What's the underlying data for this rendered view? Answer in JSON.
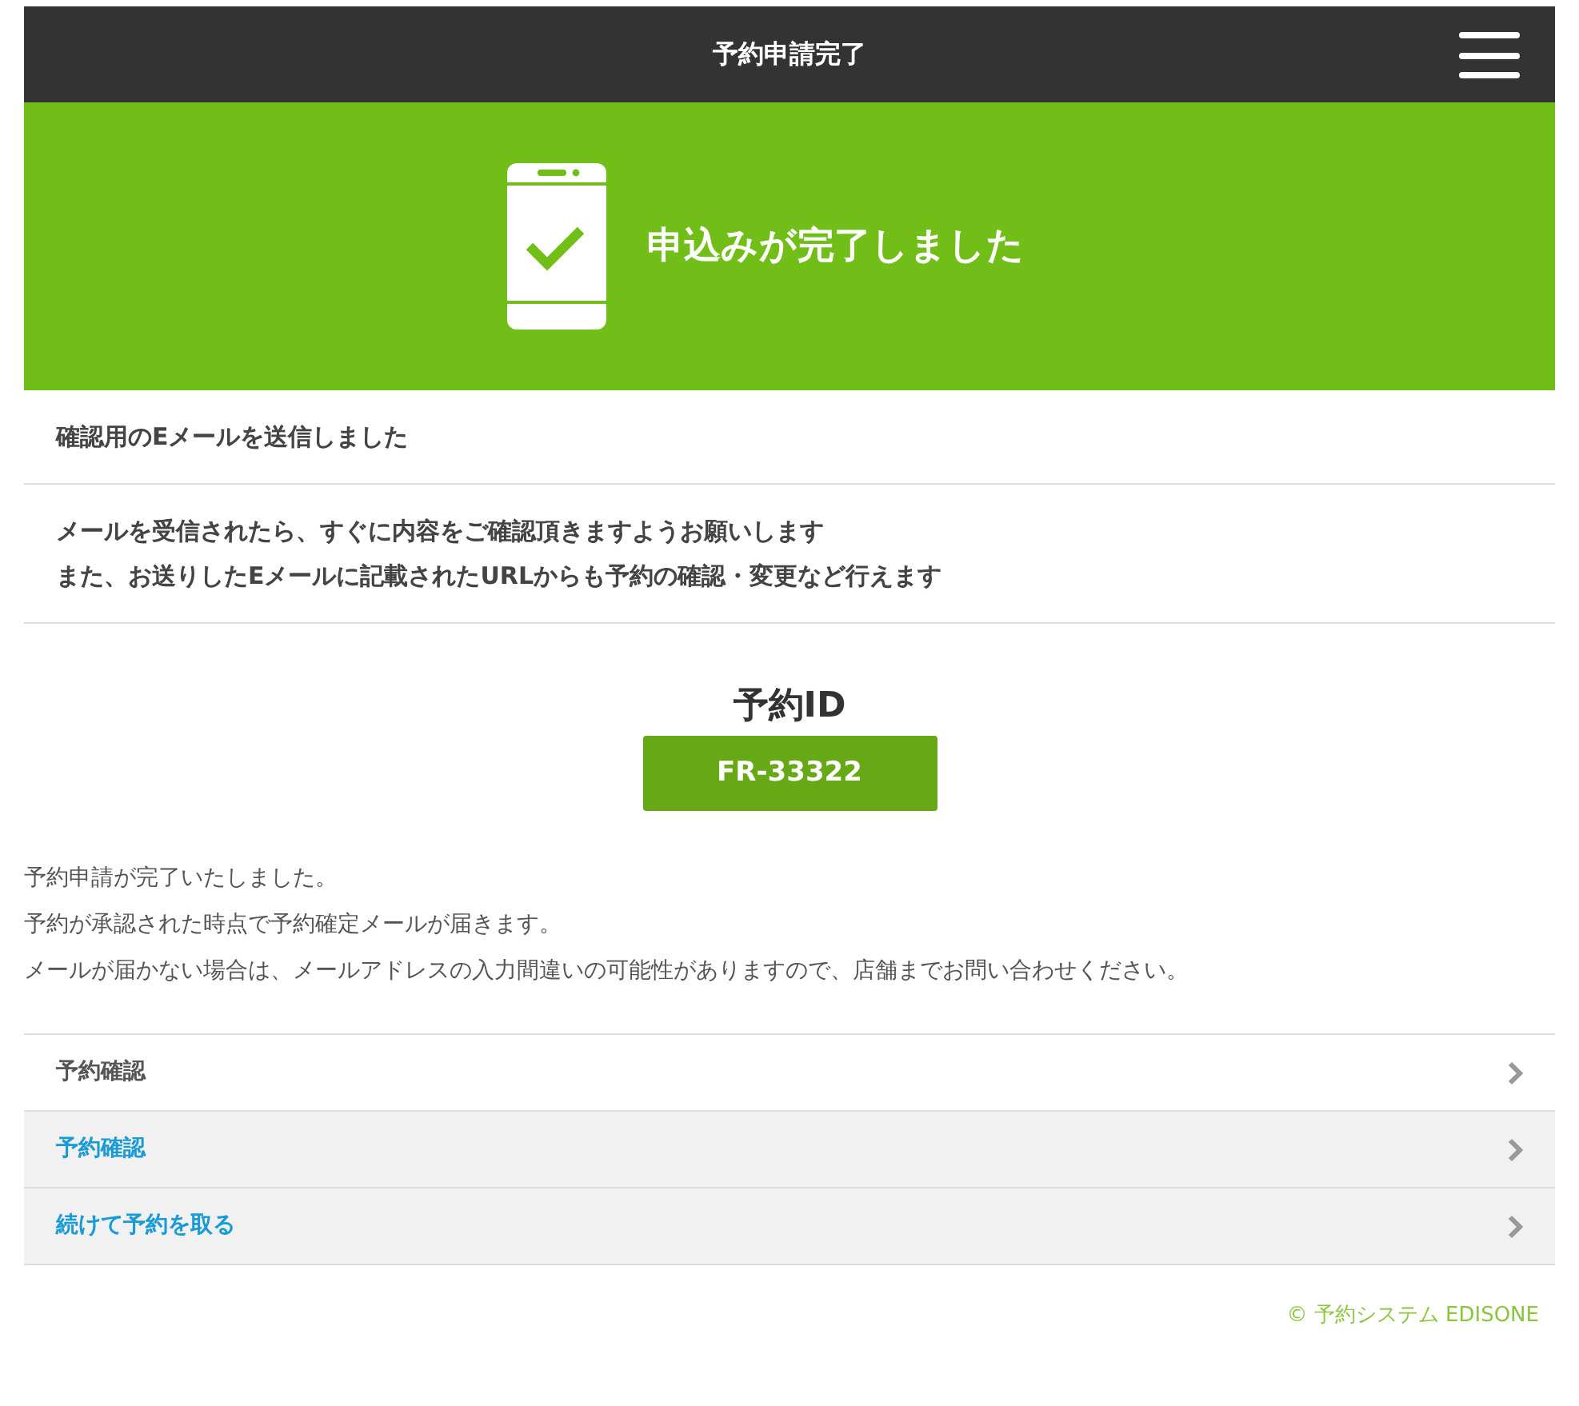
{
  "header": {
    "title": "予約申請完了"
  },
  "banner": {
    "message": "申込みが完了しました"
  },
  "notices": [
    {
      "lines": [
        "確認用のEメールを送信しました"
      ]
    },
    {
      "lines": [
        "メールを受信されたら、すぐに内容をご確認頂きますようお願いします",
        "また、お送りしたEメールに記載されたURLからも予約の確認・変更など行えます"
      ]
    }
  ],
  "reservation": {
    "label": "予約ID",
    "id": "FR-33322"
  },
  "description": [
    "予約申請が完了いたしました。",
    "予約が承認された時点で予約確定メールが届きます。",
    "メールが届かない場合は、メールアドレスの入力間違いの可能性がありますので、店舗までお問い合わせください。"
  ],
  "links": [
    {
      "label": "予約確認",
      "kind": "plain"
    },
    {
      "label": "予約確認",
      "kind": "accent"
    },
    {
      "label": "続けて予約を取る",
      "kind": "accent"
    }
  ],
  "footer": {
    "copyright": "© 予約システム EDISONE"
  }
}
